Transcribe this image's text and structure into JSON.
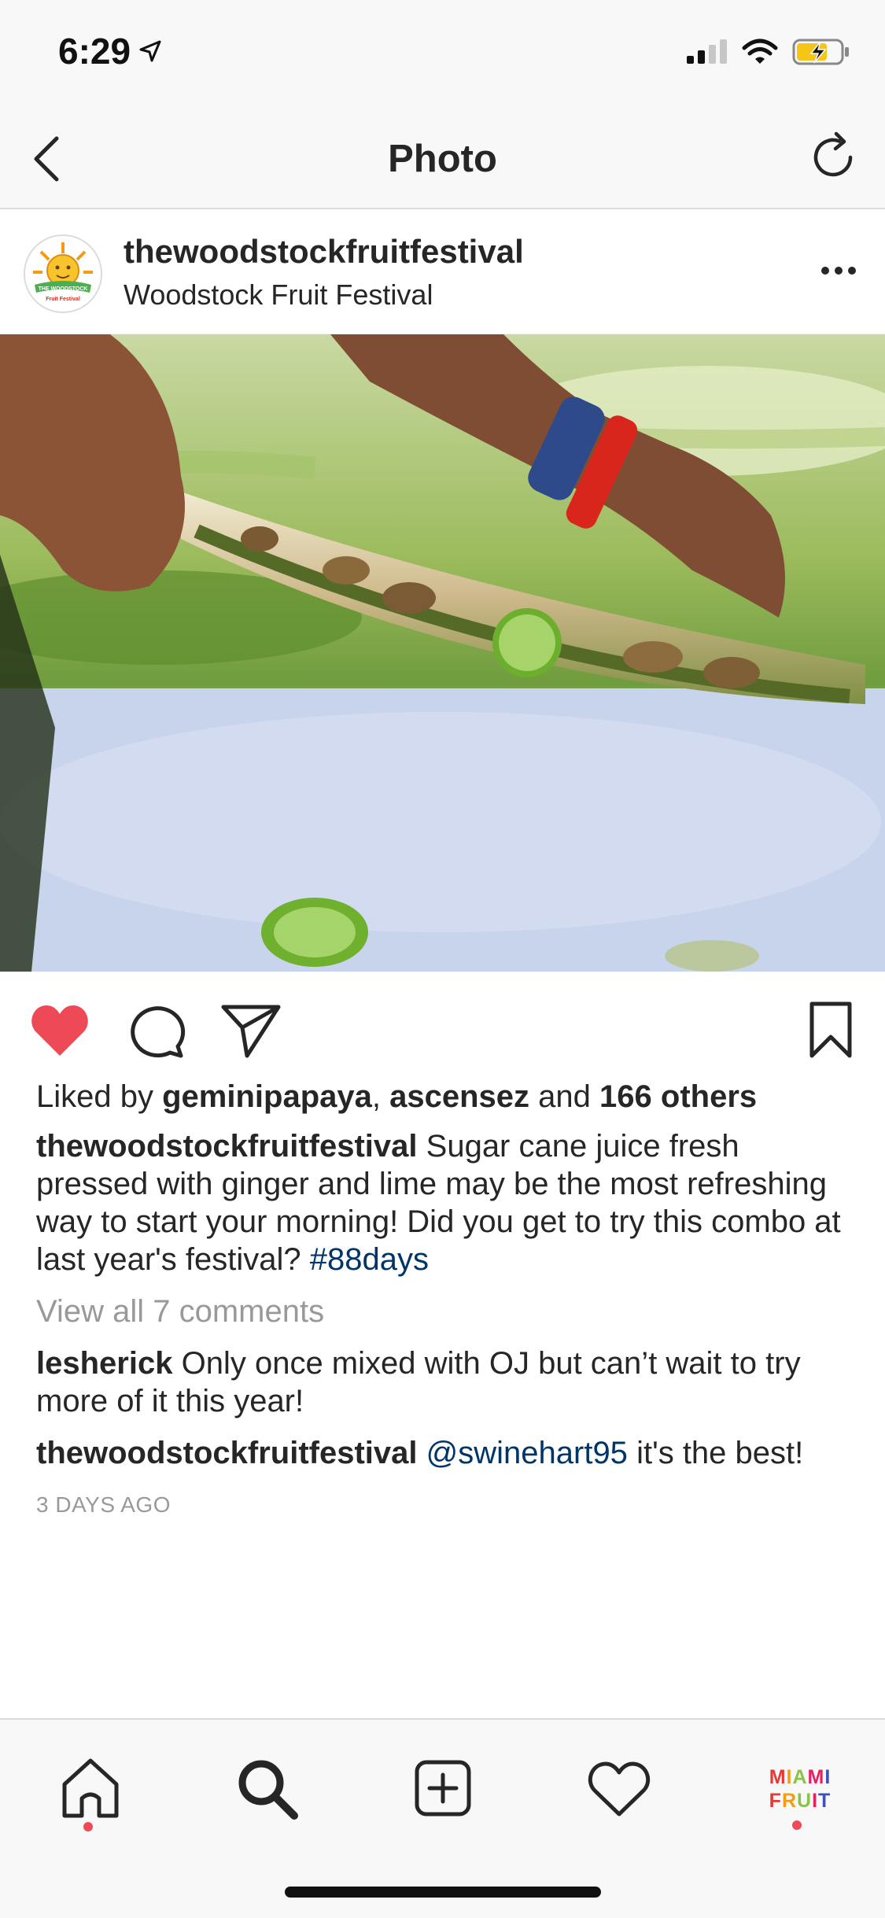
{
  "status": {
    "time": "6:29"
  },
  "nav": {
    "title": "Photo"
  },
  "post": {
    "username": "thewoodstockfruitfestival",
    "location": "Woodstock Fruit Festival",
    "avatar_text": "THE WOODSTOCK",
    "avatar_subtext": "Fruit Festival",
    "liked_by_prefix": "Liked by",
    "liked_by_user1": "geminipapaya",
    "liked_by_sep": ",",
    "liked_by_user2": "ascensez",
    "liked_by_and": "and",
    "liked_by_others": "166 others",
    "caption_user": "thewoodstockfruitfestival",
    "caption_text": "Sugar cane juice fresh pressed with ginger and lime may be the most refreshing way to start your morning! Did you get to try this combo at last year's festival?",
    "caption_hashtag": "#88days",
    "view_all_comments": "View all 7 comments",
    "comments": [
      {
        "user": "lesherick",
        "text": "Only once mixed with OJ but can’t wait to try more of it this year!"
      },
      {
        "user": "thewoodstockfruitfestival",
        "mention": "@swinehart95",
        "text": "it's the best!"
      }
    ],
    "timestamp": "3 DAYS AGO",
    "liked": true
  },
  "tab_bar": {
    "profile_logo_line1": "MIAMI",
    "profile_logo_line2": "FRUIT"
  },
  "colors": {
    "heart": "#ed4956",
    "link": "#003569",
    "muted": "#999999",
    "battery": "#f5c518"
  },
  "icons": [
    "location-arrow-icon",
    "signal-icon",
    "wifi-icon",
    "battery-charging-icon",
    "back-chevron-icon",
    "refresh-icon",
    "more-options-icon",
    "heart-filled-icon",
    "comment-icon",
    "share-icon",
    "bookmark-icon",
    "home-icon",
    "search-icon",
    "add-post-icon",
    "activity-heart-icon"
  ]
}
